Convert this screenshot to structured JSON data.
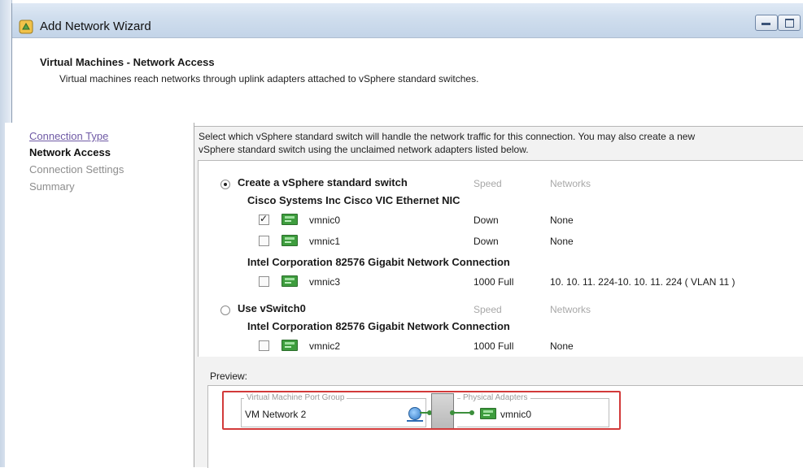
{
  "window": {
    "title": "Add Network Wizard"
  },
  "header": {
    "title": "Virtual Machines - Network Access",
    "subtitle": "Virtual machines reach networks through uplink adapters attached to vSphere standard switches."
  },
  "nav": {
    "items": [
      {
        "label": "Connection Type",
        "state": "link"
      },
      {
        "label": "Network Access",
        "state": "current"
      },
      {
        "label": "Connection Settings",
        "state": "disabled"
      },
      {
        "label": "Summary",
        "state": "disabled"
      }
    ]
  },
  "main": {
    "description_line1": "Select which vSphere standard switch will handle the network traffic for this connection. You may also create a new",
    "description_line2": "vSphere standard switch using the unclaimed network adapters listed below."
  },
  "switch_list": {
    "col_speed": "Speed",
    "col_networks": "Networks",
    "options": [
      {
        "label": "Create a vSphere standard switch",
        "selected": true,
        "vendor1": "Cisco Systems Inc Cisco VIC Ethernet NIC",
        "nics1": [
          {
            "name": "vmnic0",
            "checked": true,
            "speed": "Down",
            "networks": "None"
          },
          {
            "name": "vmnic1",
            "checked": false,
            "speed": "Down",
            "networks": "None"
          }
        ],
        "vendor2": "Intel Corporation 82576 Gigabit Network Connection",
        "nics2": [
          {
            "name": "vmnic3",
            "checked": false,
            "speed": "1000 Full",
            "networks": "10. 10. 11. 224-10. 10. 11. 224 ( VLAN 11 )"
          }
        ]
      },
      {
        "label": "Use vSwitch0",
        "selected": false,
        "vendor1": "Intel Corporation 82576 Gigabit Network Connection",
        "nics1": [
          {
            "name": "vmnic2",
            "checked": false,
            "speed": "1000 Full",
            "networks": "None"
          }
        ]
      }
    ]
  },
  "preview": {
    "label": "Preview:",
    "port_group_caption": "Virtual Machine Port Group",
    "port_group_name": "VM Network 2",
    "adapters_caption": "Physical Adapters",
    "adapter_name": "vmnic0"
  },
  "colors": {
    "highlight_frame": "#d23a3a",
    "link": "#6f5aa5",
    "nic_green": "#3e9d3e"
  }
}
